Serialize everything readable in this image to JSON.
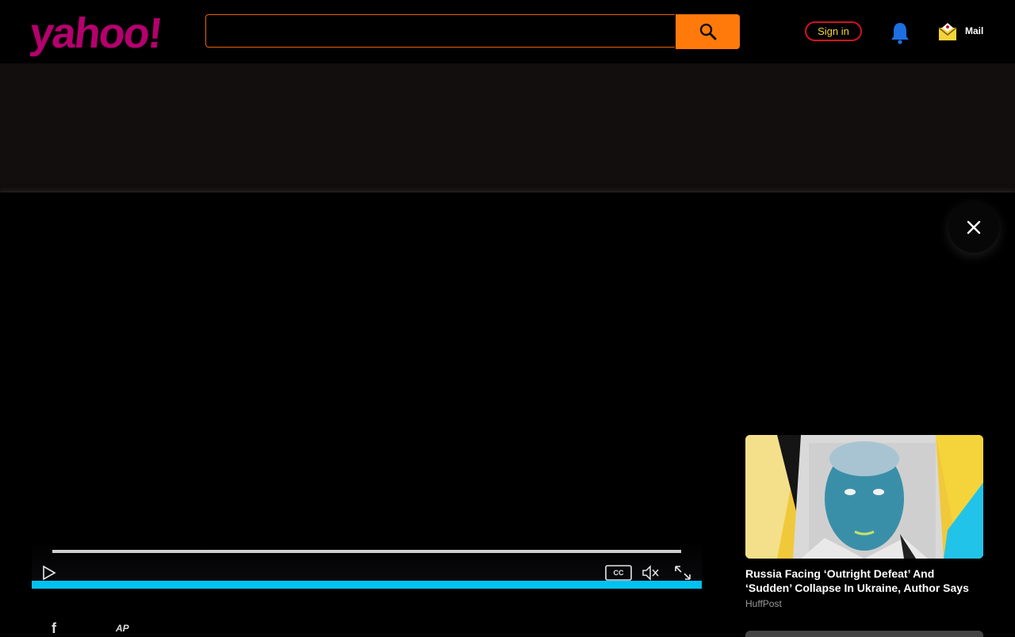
{
  "header": {
    "logo_text": "yahoo!",
    "search": {
      "value": "",
      "placeholder": ""
    },
    "signin_label": "Sign in",
    "mail_label": "Mail",
    "icons": {
      "search": "search-icon",
      "bell": "bell-icon",
      "mail": "mail-icon"
    }
  },
  "player": {
    "controls": {
      "play": "play-icon",
      "captions_label": "CC",
      "mute": "mute-icon",
      "fullscreen": "fullscreen-icon"
    }
  },
  "modal": {
    "close": "close-icon"
  },
  "recommendations": [
    {
      "title": "Russia Facing ‘Outright Defeat’ And ‘Sudden’ Collapse In Ukraine, Author Says",
      "source": "HuffPost"
    }
  ],
  "footer": {
    "share_facebook": "f",
    "ap_label": "AP"
  },
  "colors": {
    "logo": "#b5006e",
    "search_button": "#ff7a0a",
    "progress": "#00c2f0",
    "signin_border": "#d0141c"
  }
}
